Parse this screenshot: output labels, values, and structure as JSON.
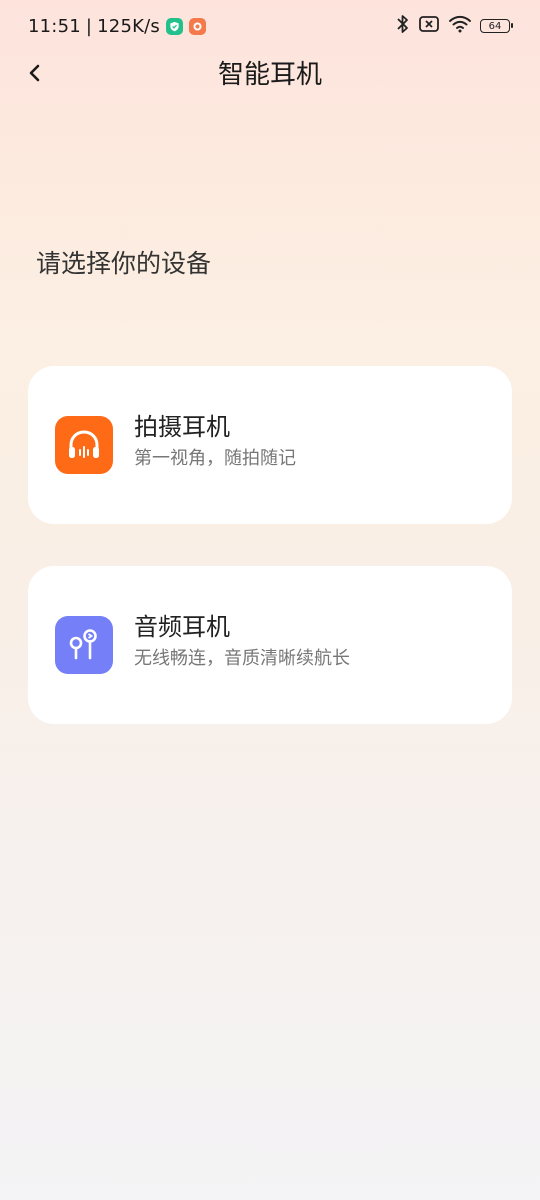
{
  "status_bar": {
    "time": "11:51",
    "separator": "|",
    "network_speed": "125K/s",
    "battery_level": "64",
    "icons": [
      "shield-app-icon",
      "orange-app-icon",
      "bluetooth-icon",
      "no-sim-icon",
      "wifi-icon",
      "battery-icon"
    ]
  },
  "header": {
    "back_icon": "chevron-left-icon",
    "title": "智能耳机"
  },
  "main": {
    "heading": "请选择你的设备",
    "devices": [
      {
        "title": "拍摄耳机",
        "subtitle": "第一视角，随拍随记",
        "icon": "headphones-icon",
        "icon_color": "#ff6a17"
      },
      {
        "title": "音频耳机",
        "subtitle": "无线畅连，音质清晰续航长",
        "icon": "earbuds-icon",
        "icon_color": "#757ff8"
      }
    ]
  },
  "colors": {
    "card_background": "#ffffff",
    "subtitle": "#777777"
  }
}
